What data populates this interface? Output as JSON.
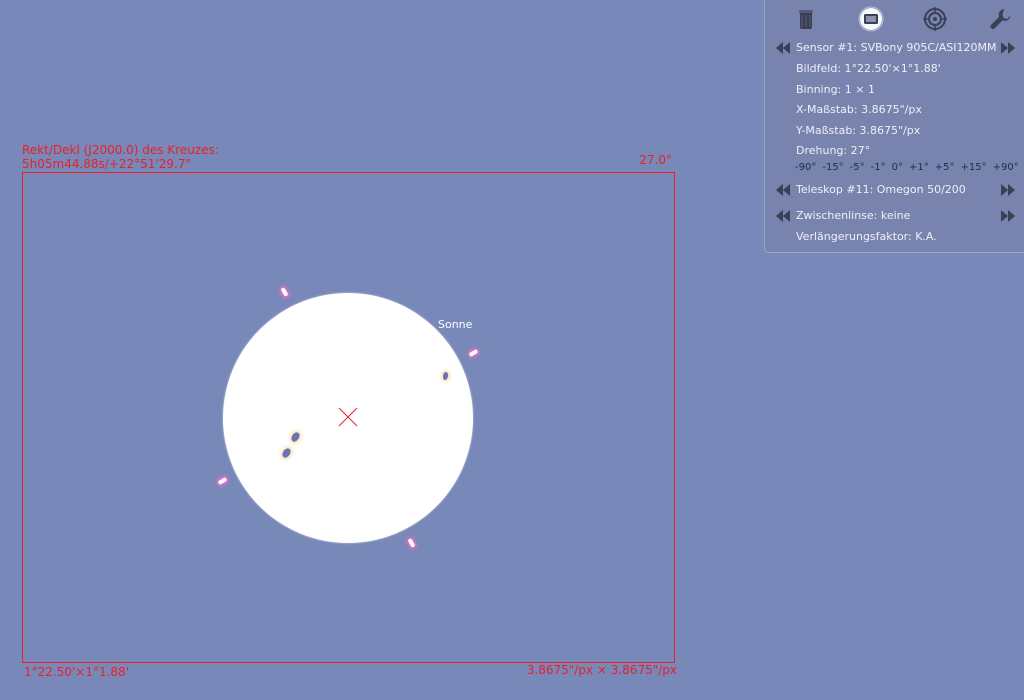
{
  "overlay": {
    "coord_title": "Rekt/Dekl (J2000.0) des Kreuzes:",
    "coord_value": "5h05m44.88s/+22°51'29.7\"",
    "rotation": "27.0°",
    "fov": "1°22.50'×1°1.88'",
    "scale": "3.8675\"/px × 3.8675\"/px",
    "frame_color": "#e8202a"
  },
  "sky": {
    "object_label": "Sonne",
    "background_color": "#7888b9"
  },
  "panel": {
    "toolbar": {
      "icons": [
        "eyepiece-icon",
        "sensor-icon",
        "telrad-icon",
        "wrench-icon"
      ]
    },
    "sensor": {
      "name": "Sensor #1: SVBony 905C/ASI120MM",
      "field": "Bildfeld: 1°22.50'×1°1.88'",
      "binning": "Binning: 1 × 1",
      "x_scale": "X-Maßstab: 3.8675\"/px",
      "y_scale": "Y-Maßstab: 3.8675\"/px",
      "rotation": "Drehung: 27°",
      "rotation_buttons": [
        "-90°",
        "-15°",
        "-5°",
        "-1°",
        "0°",
        "+1°",
        "+5°",
        "+15°",
        "+90°"
      ]
    },
    "telescope": {
      "name": "Teleskop #11: Omegon 50/200"
    },
    "lens": {
      "name": "Zwischenlinse: keine",
      "factor": "Verlängerungsfaktor: K.A."
    }
  }
}
